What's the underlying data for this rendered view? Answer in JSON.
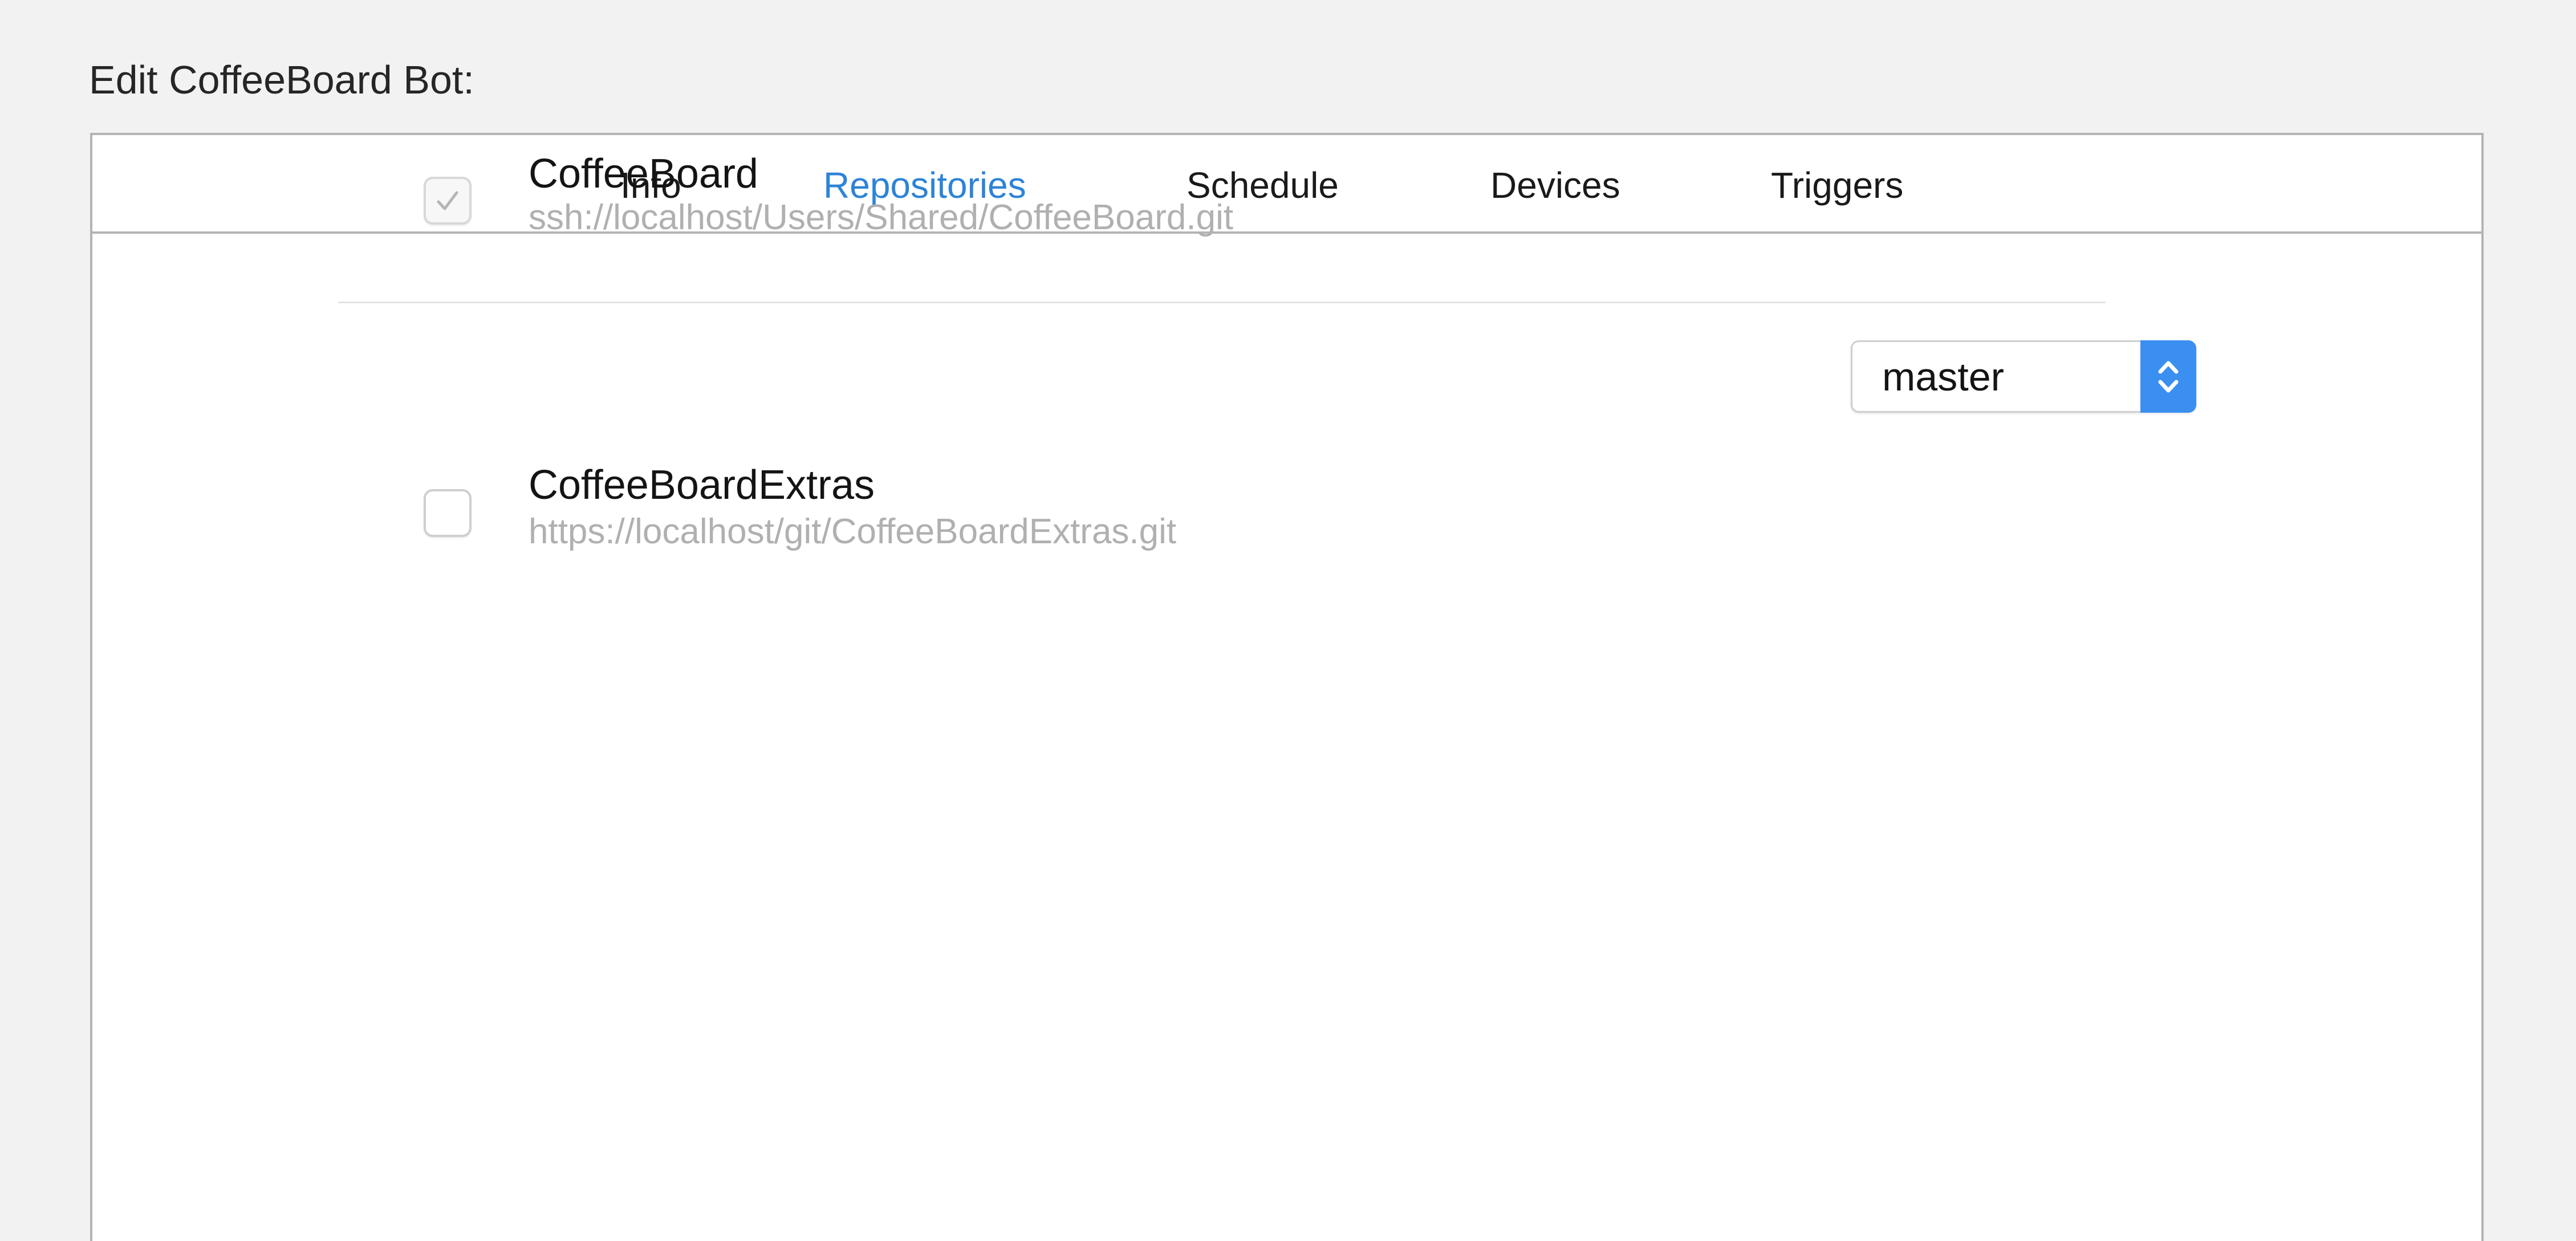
{
  "window": {
    "title": "Edit CoffeeBoard Bot:"
  },
  "tabs": [
    {
      "label": "Info",
      "active": false
    },
    {
      "label": "Repositories",
      "active": true
    },
    {
      "label": "Schedule",
      "active": false
    },
    {
      "label": "Devices",
      "active": false
    },
    {
      "label": "Triggers",
      "active": false
    }
  ],
  "repositories": [
    {
      "name": "CoffeeBoard",
      "url": "ssh://localhost/Users/Shared/CoffeeBoard.git",
      "checked": true,
      "branch": "master"
    },
    {
      "name": "CoffeeBoardExtras",
      "url": "https://localhost/git/CoffeeBoardExtras.git",
      "checked": false
    }
  ],
  "colors": {
    "active_tab": "#2d84d6",
    "stepper": "#3a8ff0",
    "secondary_text": "#b0b0b0"
  }
}
